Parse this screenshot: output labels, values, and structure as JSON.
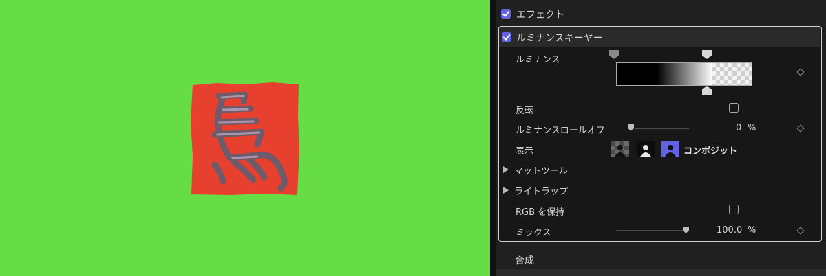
{
  "viewer": {
    "background_color": "#66dd44",
    "seal_color": "#e8402e"
  },
  "inspector": {
    "effects_header": {
      "label": "エフェクト",
      "checked": true
    },
    "luma_keyer": {
      "title": "ルミナンスキーヤー",
      "checked": true,
      "luminance_label": "ルミナンス",
      "invert_label": "反転",
      "invert_checked": false,
      "rolloff_label": "ルミナンスロールオフ",
      "rolloff_value": "0",
      "rolloff_unit": "%",
      "view_label": "表示",
      "view_mode": "コンポジット",
      "matte_tools_label": "マットツール",
      "light_wrap_label": "ライトラップ",
      "preserve_rgb_label": "RGB を保持",
      "preserve_rgb_checked": false,
      "mix_label": "ミックス",
      "mix_value": "100.0",
      "mix_unit": "%",
      "mix_level": 1.0,
      "rolloff_level": 0.0
    },
    "composite_label": "合成",
    "accent_color": "#6262e6"
  }
}
